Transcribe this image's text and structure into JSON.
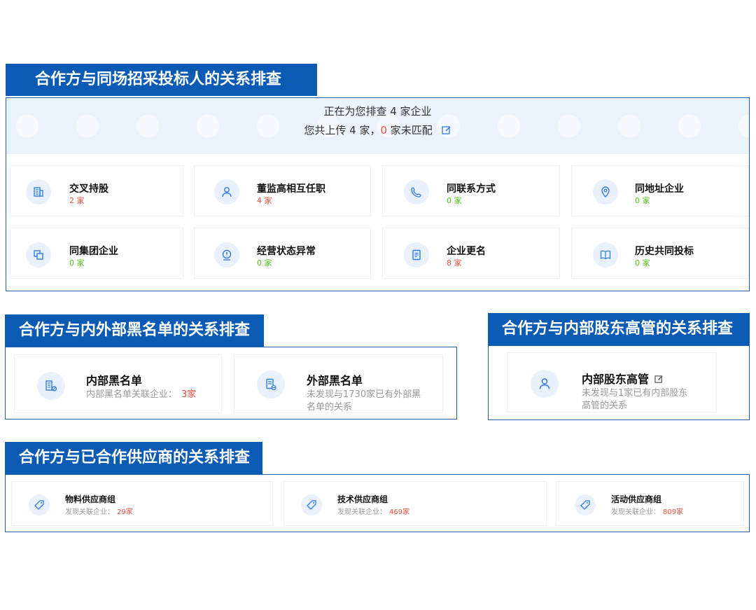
{
  "colors": {
    "brand": "#0b5bb5",
    "red": "#f04f3c",
    "green": "#52c41a",
    "icon_bg": "#e8f1fc",
    "icon_fg": "#2f7ae5"
  },
  "section1": {
    "title": "合作方与同场招采投标人的关系排查",
    "banner_line1": "正在为您排查 4 家企业",
    "banner_line2_prefix": "您共上传 4 家，",
    "banner_unmatched": "0",
    "banner_line2_suffix": " 家未匹配",
    "cards": [
      {
        "title": "交叉持股",
        "count": "2 家",
        "icon": "building-icon"
      },
      {
        "title": "董监高相互任职",
        "count": "4 家",
        "icon": "person-icon"
      },
      {
        "title": "同联系方式",
        "count": "0 家",
        "icon": "phone-icon"
      },
      {
        "title": "同地址企业",
        "count": "0 家",
        "icon": "location-pin-icon"
      },
      {
        "title": "同集团企业",
        "count": "0 家",
        "icon": "group-icon"
      },
      {
        "title": "经营状态异常",
        "count": "0 家",
        "icon": "warning-icon"
      },
      {
        "title": "企业更名",
        "count": "8 家",
        "icon": "document-icon"
      },
      {
        "title": "历史共同投标",
        "count": "0 家",
        "icon": "book-icon"
      }
    ]
  },
  "section2": {
    "title": "合作方与内外部黑名单的关系排查",
    "cards": [
      {
        "title": "内部黑名单",
        "sub_prefix": "内部黑名单关联企业：",
        "sub_value": "3家",
        "icon": "building-block-icon"
      },
      {
        "title": "外部黑名单",
        "sub_line1": "未发现与1730家已有外部黑",
        "sub_line2": "名单的关系",
        "icon": "document-block-icon"
      }
    ]
  },
  "section3": {
    "title": "合作方与内部股东高管的关系排查",
    "card": {
      "title": "内部股东高管",
      "sub_line1": "未发现与1家已有内部股东",
      "sub_line2": "高管的关系",
      "icon": "person-icon"
    }
  },
  "section4": {
    "title": "合作方与已合作供应商的关系排查",
    "cards": [
      {
        "title": "物料供应商组",
        "sub_prefix": "发现关联企业：",
        "sub_value": "29家",
        "icon": "tag-icon"
      },
      {
        "title": "技术供应商组",
        "sub_prefix": "发现关联企业：",
        "sub_value": "469家",
        "icon": "tag-icon"
      },
      {
        "title": "活动供应商组",
        "sub_prefix": "发现关联企业：",
        "sub_value": "809家",
        "icon": "tag-icon"
      }
    ]
  }
}
